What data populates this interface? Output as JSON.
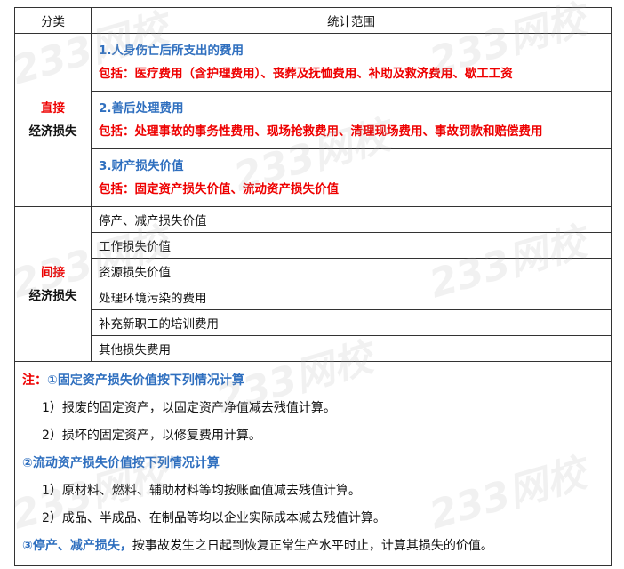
{
  "header": {
    "col1": "分类",
    "col2": "统计范围"
  },
  "direct": {
    "cat_line1": "直接",
    "cat_line2": "经济损失",
    "items": [
      {
        "title": "1.人身伤亡后所支出的费用",
        "detail": "包括：医疗费用（含护理费用）、丧葬及抚恤费用、补助及救济费用、歇工工资"
      },
      {
        "title": "2.善后处理费用",
        "detail": "包括：处理事故的事务性费用、现场抢救费用、清理现场费用、事故罚款和赔偿费用"
      },
      {
        "title": "3.财产损失价值",
        "detail": "包括：固定资产损失价值、流动资产损失价值"
      }
    ]
  },
  "indirect": {
    "cat_line1": "间接",
    "cat_line2": "经济损失",
    "items": [
      "停产、减产损失价值",
      "工作损失价值",
      "资源损失价值",
      "处理环境污染的费用",
      "补充新职工的培训费用",
      "其他损失费用"
    ]
  },
  "notes": {
    "prefix": "注：",
    "n1_title": "①固定资产损失价值按下列情况计算",
    "n1_items": [
      "1）报废的固定资产，以固定资产净值减去残值计算。",
      "2）损坏的固定资产，以修复费用计算。"
    ],
    "n2_title": "②流动资产损失价值按下列情况计算",
    "n2_items": [
      "1）原材料、燃料、辅助材料等均按账面值减去残值计算。",
      "2）成品、半成品、在制品等均以企业实际成本减去残值计算。"
    ],
    "n3_title": "③停产、减产损失，",
    "n3_text": "按事故发生之日起到恢复正常生产水平时止，计算其损失的价值。"
  },
  "watermark": "233网校"
}
